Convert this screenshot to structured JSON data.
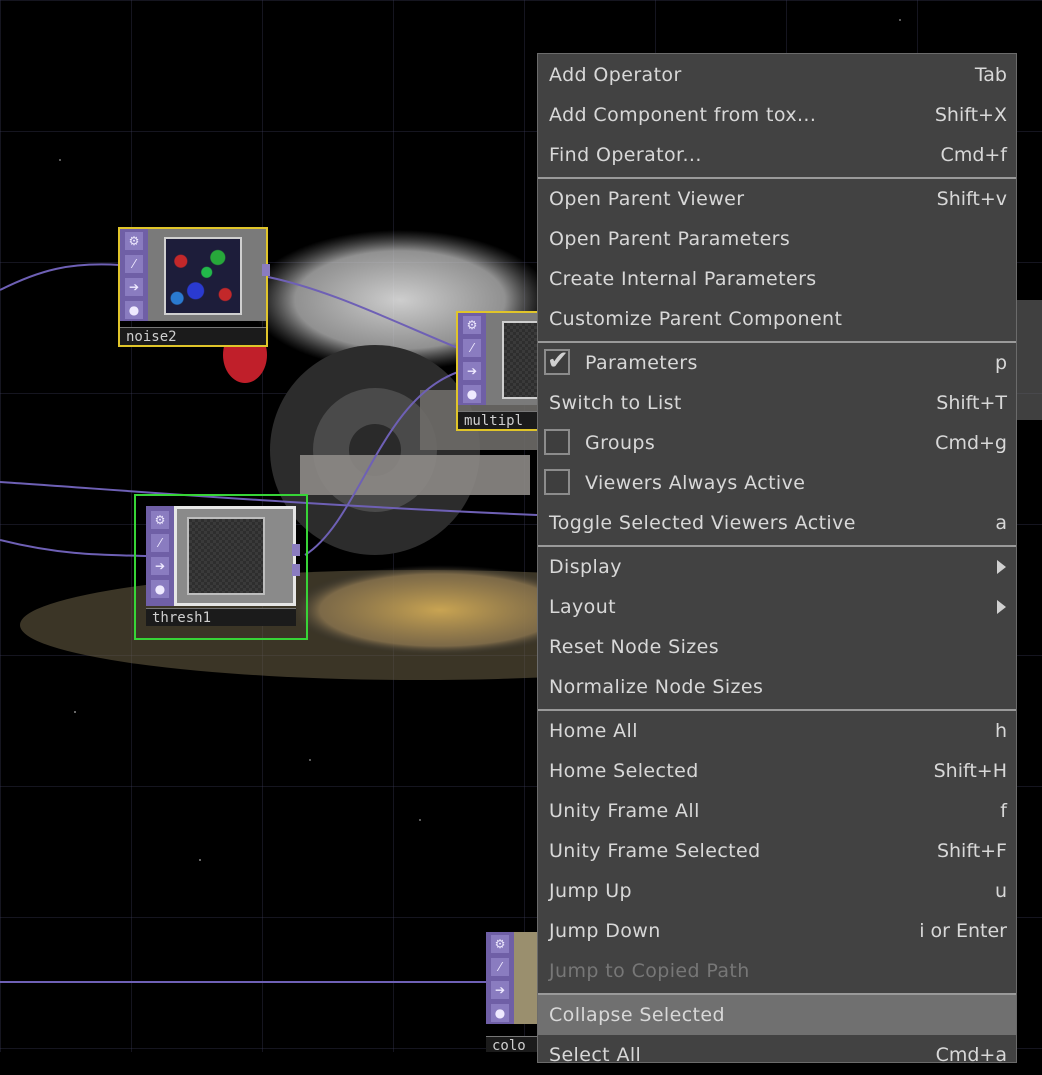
{
  "network": {
    "nodes": [
      {
        "id": "noise2",
        "label": "noise2",
        "select_color": "#e0c52a",
        "preview": "noise"
      },
      {
        "id": "multiply",
        "label": "multipl",
        "select_color": "#e0c52a",
        "preview": "grid"
      },
      {
        "id": "thresh1",
        "label": "thresh1",
        "select_color": "#37d437",
        "preview": "grid"
      },
      {
        "id": "colo",
        "label": "colo",
        "select_color": "none",
        "preview": "image"
      }
    ],
    "strip_icons": [
      "gear-icon",
      "bypass-icon",
      "arrow-right-icon",
      "lock-icon"
    ]
  },
  "menu": {
    "items": [
      {
        "label": "Add Operator",
        "shortcut": "Tab"
      },
      {
        "label": "Add Component from tox...",
        "shortcut": "Shift+X"
      },
      {
        "label": "Find Operator...",
        "shortcut": "Cmd+f"
      },
      {
        "label": "Open Parent Viewer",
        "shortcut": "Shift+v"
      },
      {
        "label": "Open Parent Parameters",
        "shortcut": ""
      },
      {
        "label": "Create Internal Parameters",
        "shortcut": ""
      },
      {
        "label": "Customize Parent Component",
        "shortcut": ""
      },
      {
        "label": "Parameters",
        "shortcut": "p",
        "checked": true
      },
      {
        "label": "Switch to List",
        "shortcut": "Shift+T"
      },
      {
        "label": "Groups",
        "shortcut": "Cmd+g",
        "checked": false
      },
      {
        "label": "Viewers Always Active",
        "shortcut": "",
        "checked": false
      },
      {
        "label": "Toggle Selected Viewers Active",
        "shortcut": "a"
      },
      {
        "label": "Display",
        "shortcut": "",
        "submenu": true
      },
      {
        "label": "Layout",
        "shortcut": "",
        "submenu": true
      },
      {
        "label": "Reset Node Sizes",
        "shortcut": ""
      },
      {
        "label": "Normalize Node Sizes",
        "shortcut": ""
      },
      {
        "label": "Home All",
        "shortcut": "h"
      },
      {
        "label": "Home Selected",
        "shortcut": "Shift+H"
      },
      {
        "label": "Unity Frame All",
        "shortcut": "f"
      },
      {
        "label": "Unity Frame Selected",
        "shortcut": "Shift+F"
      },
      {
        "label": "Jump Up",
        "shortcut": "u"
      },
      {
        "label": "Jump Down",
        "shortcut": "i or Enter"
      },
      {
        "label": "Jump to Copied Path",
        "shortcut": "",
        "disabled": true
      },
      {
        "label": "Collapse Selected",
        "shortcut": "",
        "highlighted": true
      },
      {
        "label": "Select All",
        "shortcut": "Cmd+a"
      }
    ],
    "colors": {
      "background": "#424242",
      "highlight": "#707070",
      "separator": "#9a9a9a"
    }
  }
}
